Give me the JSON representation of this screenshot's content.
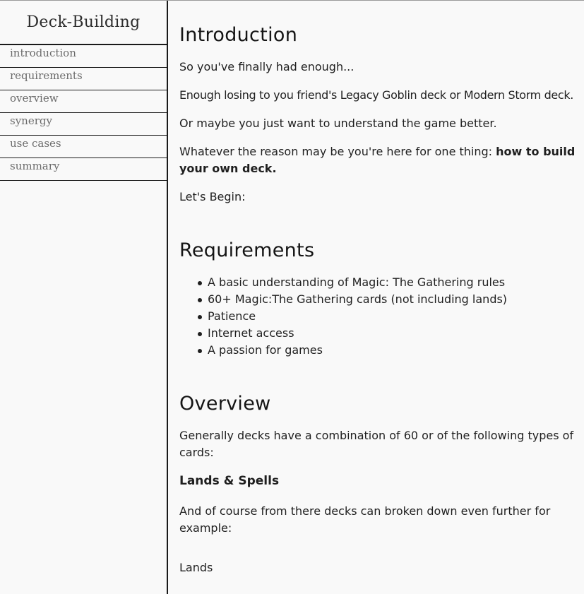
{
  "navbar": {
    "title": "Deck-Building",
    "links": [
      "introduction",
      "requirements",
      "overview",
      "synergy",
      "use cases",
      "summary"
    ]
  },
  "introduction": {
    "heading": "Introduction",
    "p1": "So you've finally had enough...",
    "p2": "Enough losing to you friend's Legacy Goblin deck or Modern Storm deck.",
    "p3": "Or maybe you just want to understand the game better.",
    "p4_plain": "Whatever the reason may be you're here for one thing: ",
    "p4_strong": "how to build your own deck.",
    "p5": "Let's Begin:"
  },
  "requirements": {
    "heading": "Requirements",
    "items": [
      "A basic understanding of Magic: The Gathering rules",
      "60+ Magic:The Gathering cards (not including lands)",
      "Patience",
      "Internet access",
      "A passion for games"
    ]
  },
  "overview": {
    "heading": "Overview",
    "p1": "Generally decks have a combination of 60 or of the following types of cards:",
    "subheading": "Lands & Spells",
    "p2": "And of course from there decks can broken down even further for example:",
    "lands_heading": "Lands"
  }
}
